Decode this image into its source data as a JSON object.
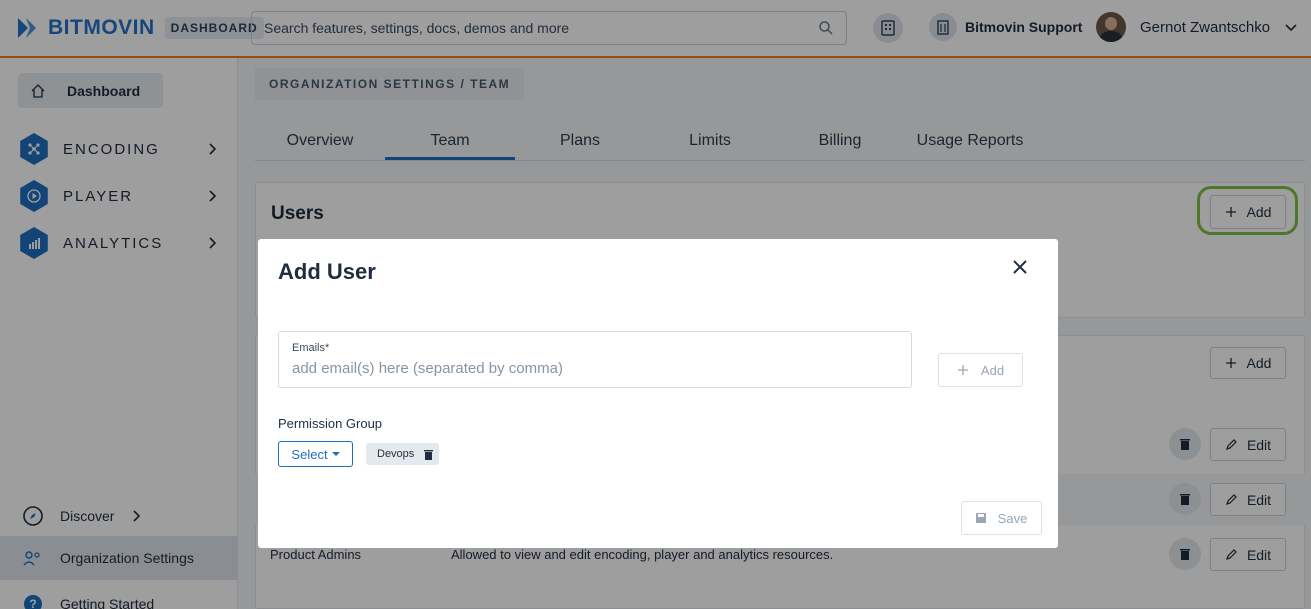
{
  "header": {
    "brand_name": "BITMOVIN",
    "brand_tag": "DASHBOARD",
    "search_placeholder": "Search features, settings, docs, demos and more",
    "support_label": "Bitmovin Support",
    "user_name": "Gernot Zwantschko"
  },
  "sidebar": {
    "dashboard_label": "Dashboard",
    "items": [
      {
        "label": "ENCODING",
        "icon": "encoding-icon"
      },
      {
        "label": "PLAYER",
        "icon": "player-icon"
      },
      {
        "label": "ANALYTICS",
        "icon": "analytics-icon"
      }
    ],
    "bottom": [
      {
        "label": "Discover",
        "icon": "compass-icon"
      },
      {
        "label": "Organization Settings",
        "icon": "organization-icon"
      },
      {
        "label": "Getting Started",
        "icon": "help-icon"
      }
    ]
  },
  "main": {
    "breadcrumb": "ORGANIZATION SETTINGS / TEAM",
    "tabs": [
      "Overview",
      "Team",
      "Plans",
      "Limits",
      "Billing",
      "Usage Reports"
    ],
    "active_tab": "Team",
    "users_title": "Users",
    "add_label": "Add",
    "edit_label": "Edit",
    "row_group_name": "Product Admins",
    "row_group_desc": "Allowed to view and edit encoding, player and analytics resources."
  },
  "modal": {
    "title": "Add User",
    "emails_label": "Emails*",
    "emails_placeholder": "add email(s) here (separated by comma)",
    "add_label": "Add",
    "permission_label": "Permission Group",
    "select_label": "Select",
    "chip_label": "Devops",
    "save_label": "Save"
  },
  "colors": {
    "accent": "#1e6fc0",
    "top_border": "#f07a2a",
    "highlight": "#7bc247"
  }
}
